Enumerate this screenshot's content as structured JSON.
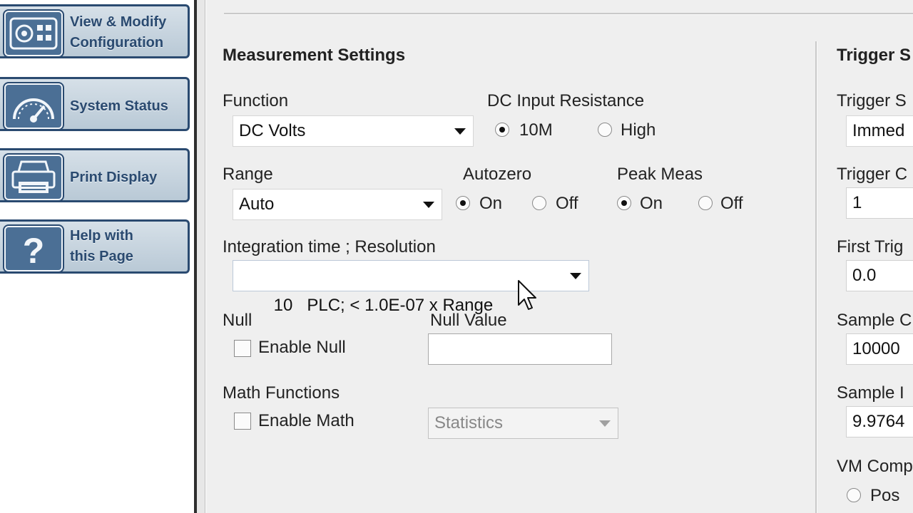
{
  "nav": {
    "items": [
      {
        "label": "View & Modify\nConfiguration",
        "icon": "configuration-icon"
      },
      {
        "label": "System Status",
        "icon": "gauge-icon"
      },
      {
        "label": "Print Display",
        "icon": "printer-icon"
      },
      {
        "label": "Help with\nthis Page",
        "icon": "question-icon"
      }
    ]
  },
  "measurement": {
    "title": "Measurement Settings",
    "function": {
      "label": "Function",
      "value": "DC Volts"
    },
    "input_resistance": {
      "label": "DC Input Resistance",
      "options": [
        "10M",
        "High"
      ],
      "selected": "10M"
    },
    "range": {
      "label": "Range",
      "value": "Auto"
    },
    "autozero": {
      "label": "Autozero",
      "options": [
        "On",
        "Off"
      ],
      "selected": "On"
    },
    "peak_meas": {
      "label": "Peak Meas",
      "options": [
        "On",
        "Off"
      ],
      "selected": "On"
    },
    "integration": {
      "label": "Integration time ; Resolution",
      "value": "10   PLC; < 1.0E-07 x Range"
    },
    "null": {
      "label": "Null",
      "checkbox_label": "Enable Null",
      "checked": false
    },
    "null_value": {
      "label": "Null Value",
      "value": ""
    },
    "math": {
      "label": "Math Functions",
      "checkbox_label": "Enable Math",
      "checked": false,
      "function_value": "Statistics"
    }
  },
  "trigger": {
    "title": "Trigger S",
    "source": {
      "label": "Trigger S",
      "value": "Immed"
    },
    "count": {
      "label": "Trigger C",
      "value": "1"
    },
    "first_delay": {
      "label": "First Trig",
      "value": "0.0"
    },
    "sample_count": {
      "label": "Sample C",
      "value": "10000"
    },
    "sample_interval": {
      "label": "Sample I",
      "value": "9.9764"
    },
    "vm_comp": {
      "label": "VM Comp",
      "option": "Pos"
    }
  },
  "colors": {
    "nav_border": "#2a4a70",
    "nav_fill": "#c7d4de",
    "icon_fill": "#4b6f95",
    "panel_bg": "#efefef"
  }
}
